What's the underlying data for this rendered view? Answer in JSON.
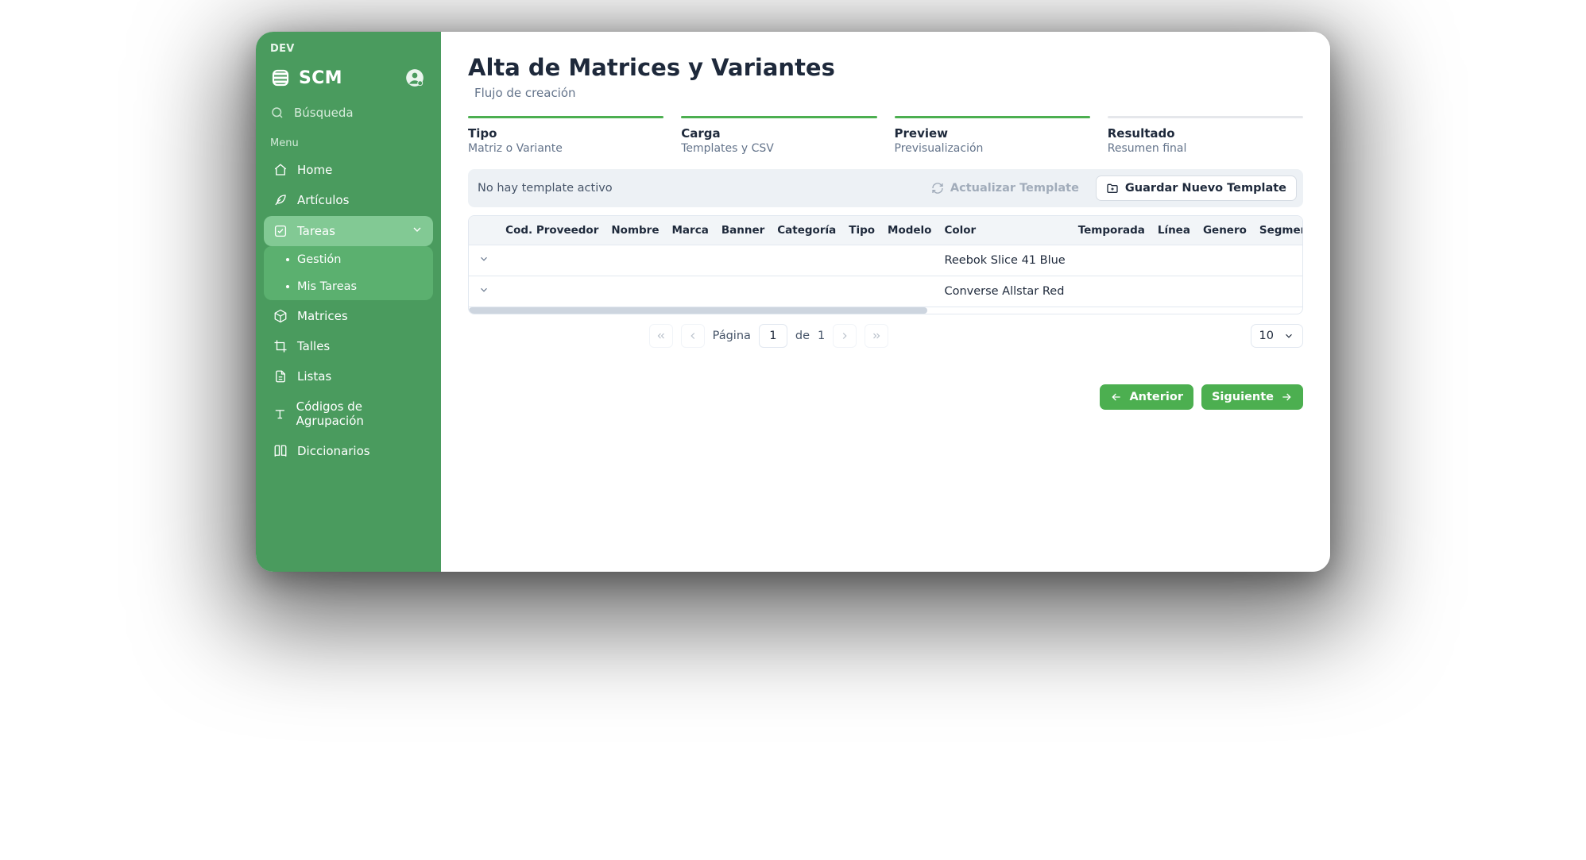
{
  "env_tag": "DEV",
  "brand": "SCM",
  "search_placeholder": "Búsqueda",
  "section_label": "Menu",
  "sidebar": {
    "items": [
      {
        "icon": "home",
        "label": "Home"
      },
      {
        "icon": "leaf",
        "label": "Artículos"
      },
      {
        "icon": "check",
        "label": "Tareas",
        "expanded": true
      },
      {
        "icon": "cube",
        "label": "Matrices"
      },
      {
        "icon": "crop",
        "label": "Talles"
      },
      {
        "icon": "file",
        "label": "Listas"
      },
      {
        "icon": "type",
        "label": "Códigos de Agrupación"
      },
      {
        "icon": "book",
        "label": "Diccionarios"
      }
    ],
    "tareas_children": [
      {
        "label": "Gestión"
      },
      {
        "label": "Mis Tareas"
      }
    ]
  },
  "page": {
    "title": "Alta de Matrices y Variantes",
    "subtitle": "Flujo de creación"
  },
  "steps": [
    {
      "title": "Tipo",
      "desc": "Matriz o Variante",
      "state": "done"
    },
    {
      "title": "Carga",
      "desc": "Templates y CSV",
      "state": "done"
    },
    {
      "title": "Preview",
      "desc": "Previsualización",
      "state": "active"
    },
    {
      "title": "Resultado",
      "desc": "Resumen final",
      "state": "pending"
    }
  ],
  "template_bar": {
    "status": "No hay template activo",
    "refresh_label": "Actualizar Template",
    "save_label": "Guardar Nuevo Template"
  },
  "table": {
    "columns": [
      "Cod. Proveedor",
      "Nombre",
      "Marca",
      "Banner",
      "Categoría",
      "Tipo",
      "Modelo",
      "Color",
      "Temporada",
      "Línea",
      "Genero",
      "Segmento"
    ],
    "rows": [
      {
        "Color": "Reebok Slice 41 Blue"
      },
      {
        "Color": "Converse Allstar Red"
      }
    ]
  },
  "pagination": {
    "label_page": "Página",
    "label_of": "de",
    "current": "1",
    "total": "1",
    "page_size": "10"
  },
  "footer": {
    "prev": "Anterior",
    "next": "Siguiente"
  }
}
